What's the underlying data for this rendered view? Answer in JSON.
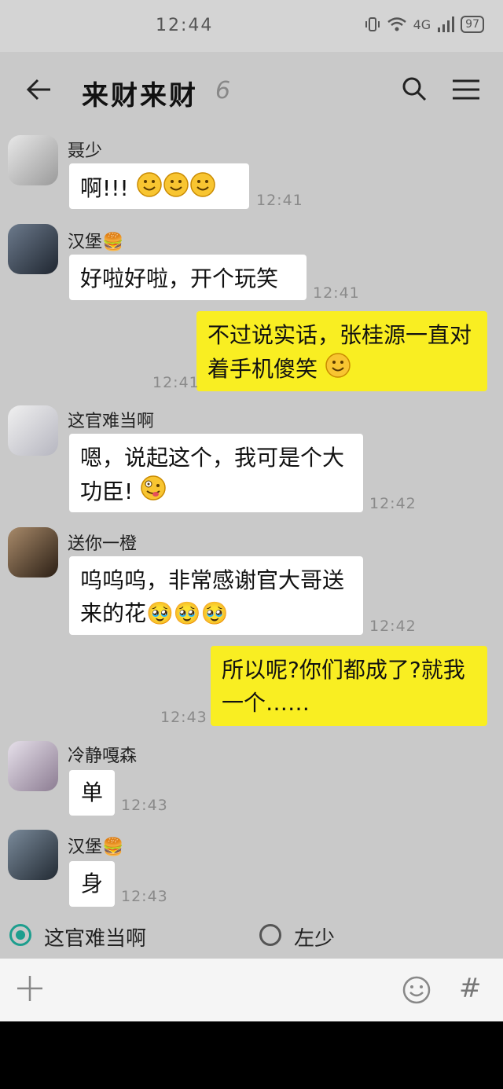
{
  "status_bar": {
    "time": "12:44",
    "network": "4G",
    "battery": "97"
  },
  "header": {
    "title": "来财来财",
    "member_count": "6"
  },
  "messages": [
    {
      "sender": "聂少",
      "text": "啊!!!",
      "emojis": 3,
      "time": "12:41",
      "mine": false
    },
    {
      "sender": "汉堡🍔",
      "text": "好啦好啦，开个玩笑",
      "time": "12:41",
      "mine": false
    },
    {
      "sender": "",
      "text": "不过说实话，张桂源一直对着手机傻笑",
      "emojis": 1,
      "time": "12:41",
      "mine": true
    },
    {
      "sender": "这官难当啊",
      "text": "嗯，说起这个，我可是个大功臣!",
      "time": "12:42",
      "mine": false
    },
    {
      "sender": "送你一橙",
      "text": "呜呜呜，非常感谢官大哥送来的花🥹🥹🥹",
      "time": "12:42",
      "mine": false
    },
    {
      "sender": "",
      "text": "所以呢?你们都成了?就我一个……",
      "time": "12:43",
      "mine": true
    },
    {
      "sender": "冷静嘎森",
      "text": "单",
      "time": "12:43",
      "mine": false
    },
    {
      "sender": "汉堡🍔",
      "text": "身",
      "time": "12:43",
      "mine": false
    }
  ],
  "role_options": [
    {
      "label": "这官难当啊",
      "selected": true
    },
    {
      "label": "左少",
      "selected": false
    }
  ],
  "input_bar": {
    "icons": [
      "plus-icon",
      "emoji-icon",
      "hash-icon"
    ],
    "hash_label": "#"
  },
  "colors": {
    "background": "#c9c9c9",
    "my_bubble": "#f9ee22",
    "other_bubble": "#ffffff",
    "radio_accent": "#1d9e8e"
  }
}
